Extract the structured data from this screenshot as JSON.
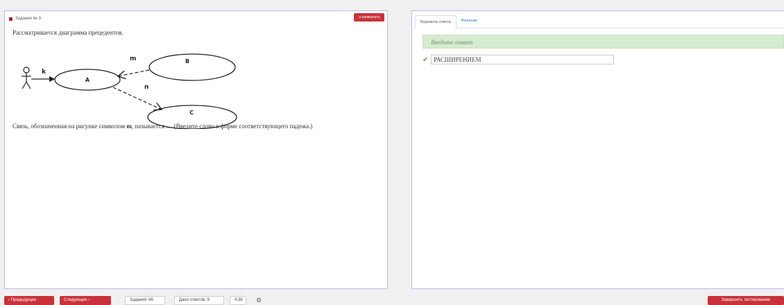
{
  "task": {
    "header": "Задание № 9",
    "expand_label": "развернуть",
    "intro": "Рассматривается диаграмма прецедентов.",
    "question_prefix": "Связь, обозначенная на рисунке символом ",
    "question_symbol": "m",
    "question_suffix": ", называется … (Введите слово в форме соответствующего падежа.)",
    "diagram": {
      "use_cases": [
        "A",
        "B",
        "C"
      ],
      "edge_labels": {
        "k": "k",
        "m": "m",
        "n": "n"
      }
    }
  },
  "answer_panel": {
    "tabs": [
      {
        "label": "Варианты ответа"
      },
      {
        "label": "Решение"
      }
    ],
    "prompt": "Введите ответ",
    "answer_value": "РАСШИРЕНИЕМ"
  },
  "footer": {
    "prev_label": "Предыдущее",
    "next_label": "Следующее",
    "tasks_label": "Заданий: 66",
    "answers_label": "Дано ответов: 9",
    "timer": "4:38",
    "finish_label": "Завершить тестирование"
  },
  "colors": {
    "accent_red": "#c8323a",
    "answer_green": "#d6ecd1",
    "panel_border": "#b9b9e6"
  },
  "icons": {
    "check": "check-icon",
    "gear": "gear-icon",
    "prev": "chevron-left-icon",
    "next": "chevron-right-icon"
  }
}
